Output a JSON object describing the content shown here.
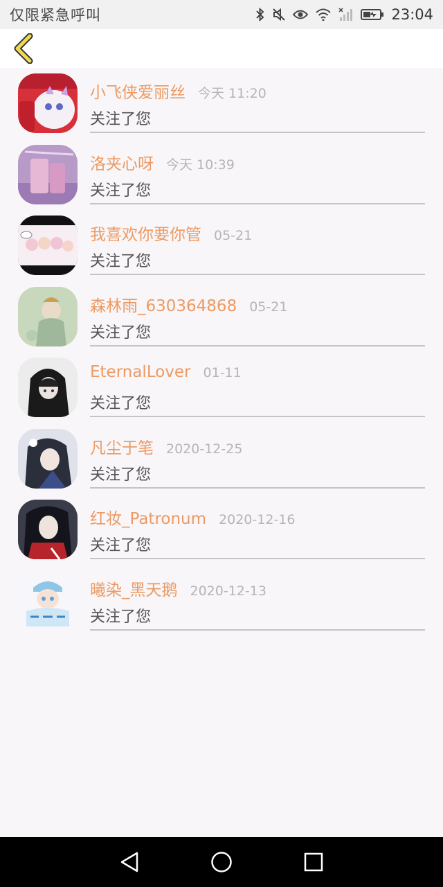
{
  "status_bar": {
    "carrier_text": "仅限紧急呼叫",
    "time": "23:04",
    "icons": [
      "bluetooth-icon",
      "mute-icon",
      "eye-icon",
      "wifi-icon",
      "signal-icon",
      "battery-icon"
    ]
  },
  "header": {
    "back_icon": "chevron-left-icon",
    "accent_color": "#f1d94a"
  },
  "notifications": [
    {
      "name": "小飞侠爱丽丝",
      "time": "今天 11:20",
      "action": "关注了您"
    },
    {
      "name": "洛夹心呀",
      "time": "今天 10:39",
      "action": "关注了您"
    },
    {
      "name": "我喜欢你要你管",
      "time": "05-21",
      "action": "关注了您"
    },
    {
      "name": "森林雨_630364868",
      "time": "05-21",
      "action": "关注了您"
    },
    {
      "name": "EternalLover",
      "time": "01-11",
      "action": "关注了您"
    },
    {
      "name": "凡尘于笔",
      "time": "2020-12-25",
      "action": "关注了您"
    },
    {
      "name": "红妆_Patronum",
      "time": "2020-12-16",
      "action": "关注了您"
    },
    {
      "name": "曦染_黑天鹅",
      "time": "2020-12-13",
      "action": "关注了您"
    }
  ],
  "nav_bar": {
    "buttons": [
      "back-triangle-icon",
      "home-circle-icon",
      "recents-square-icon"
    ]
  },
  "colors": {
    "name_color": "#ec9a63",
    "time_color": "#b5b5b5",
    "background": "#f8f6f8"
  }
}
